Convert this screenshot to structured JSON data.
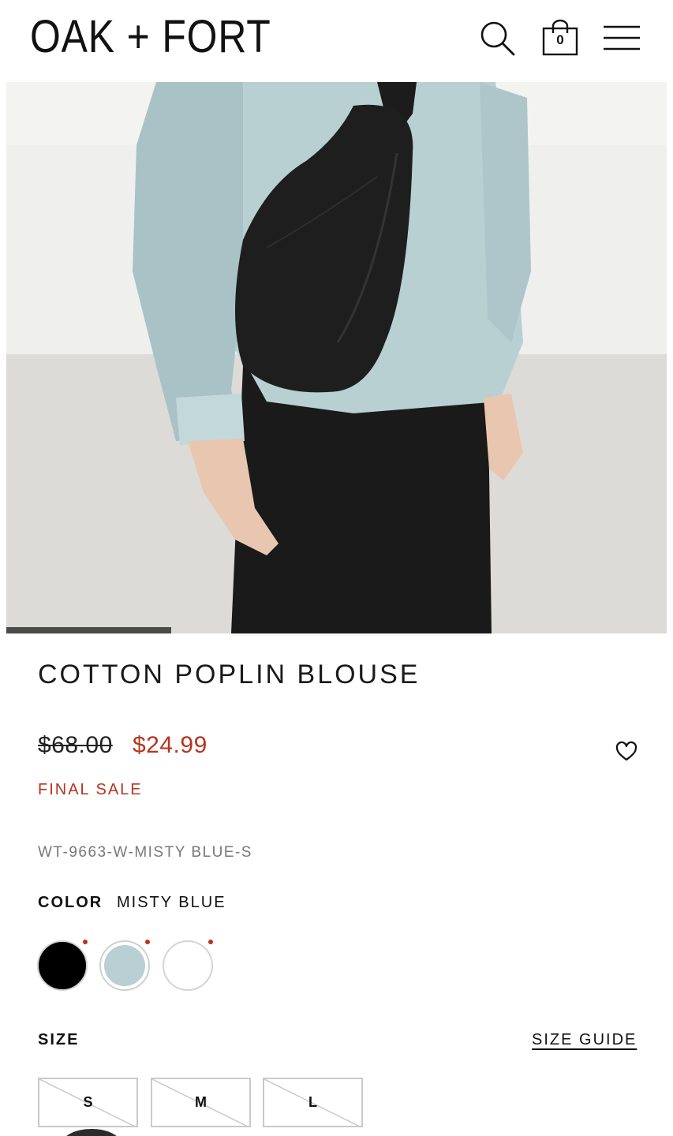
{
  "header": {
    "logo": "OAK + FORT",
    "bag_count": "0",
    "icons": {
      "search": "search-icon",
      "bag": "shopping-bag-icon",
      "menu": "hamburger-menu-icon"
    }
  },
  "gallery": {
    "image": "product-photo",
    "progress_fraction": 0.25
  },
  "product": {
    "title": "COTTON POPLIN BLOUSE",
    "price_original": "$68.00",
    "price_sale": "$24.99",
    "sale_note": "FINAL SALE",
    "sku": "WT-9663-W-MISTY BLUE-S",
    "wishlist_icon": "heart-outline-icon"
  },
  "color": {
    "label": "COLOR",
    "selected": "MISTY BLUE",
    "swatches": [
      {
        "name": "Black",
        "hex": "#000000"
      },
      {
        "name": "Misty Blue",
        "hex": "#b9cfd3"
      },
      {
        "name": "White",
        "hex": "#ffffff"
      }
    ],
    "indicator_color": "#b8331f"
  },
  "size": {
    "label": "SIZE",
    "guide_link": "SIZE GUIDE",
    "options": [
      "S",
      "M",
      "L"
    ]
  },
  "colors": {
    "sale_red": "#b8331f",
    "text": "#111111",
    "muted": "#777777"
  }
}
